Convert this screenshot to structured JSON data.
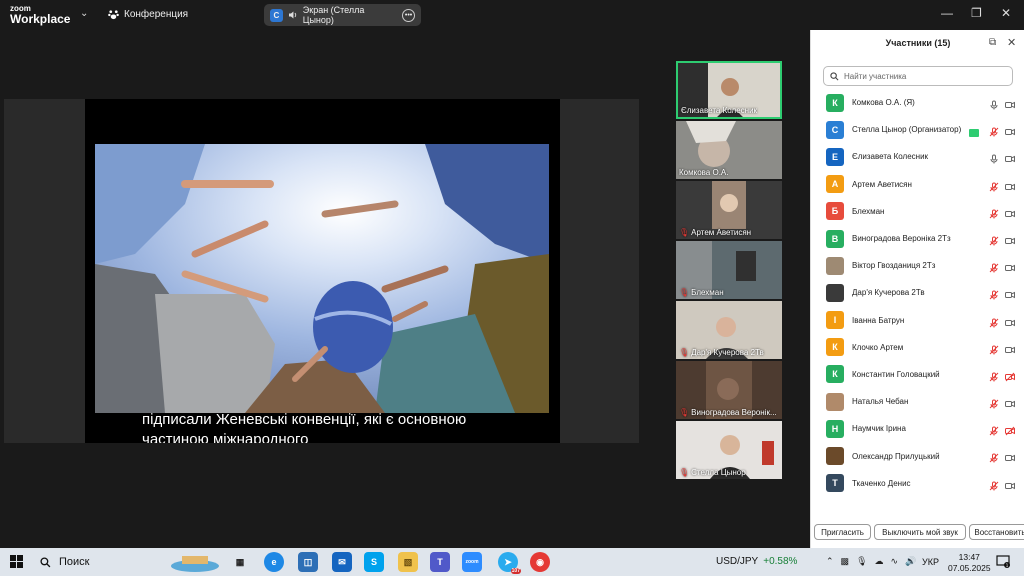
{
  "app": {
    "logo_line1": "zoom",
    "logo_line2": "Workplace",
    "meeting_label": "Конференция",
    "screen_label": "Экран (Стелла Цынор)",
    "screen_badge": "C"
  },
  "shared_screen": {
    "subtitle": "підписали Женевські конвенції, які є основною частиною міжнародного"
  },
  "thumbnails": [
    {
      "name": "Єлизавета Колесник",
      "muted": false,
      "active": true
    },
    {
      "name": "Комкова О.А.",
      "muted": false,
      "active": false
    },
    {
      "name": "Артем Аветисян",
      "muted": true,
      "active": false
    },
    {
      "name": "Блехман",
      "muted": true,
      "active": false
    },
    {
      "name": "Дар'я Кучерова 2Тв",
      "muted": true,
      "active": false
    },
    {
      "name": "Виноградова Веронік...",
      "muted": true,
      "active": false
    },
    {
      "name": "Стелла Цынор",
      "muted": true,
      "active": false
    }
  ],
  "participants_panel": {
    "title": "Участники (15)",
    "search_placeholder": "Найти участника",
    "participants": [
      {
        "name": "Комкова О.А. (Я)",
        "initial": "К",
        "color": "#27ae60",
        "mic": "on",
        "video": "on"
      },
      {
        "name": "Стелла Цынор (Организатор)",
        "initial": "С",
        "color": "#2a7fd4",
        "mic": "off",
        "video": "on",
        "sharing": true
      },
      {
        "name": "Єлизавета Колесник",
        "initial": "Е",
        "color": "#1565c0",
        "mic": "on",
        "video": "on"
      },
      {
        "name": "Артем Аветисян",
        "initial": "А",
        "color": "#f39c12",
        "mic": "off",
        "video": "on"
      },
      {
        "name": "Блехман",
        "initial": "Б",
        "color": "#e74c3c",
        "mic": "off",
        "video": "on"
      },
      {
        "name": "Виноградова Вероніка 2Тз",
        "initial": "В",
        "color": "#27ae60",
        "mic": "off",
        "video": "on"
      },
      {
        "name": "Віктор Гвозданиця 2Тз",
        "initial": "",
        "color": "#9e8a73",
        "mic": "off",
        "video": "on"
      },
      {
        "name": "Дар'я Кучерова 2Тв",
        "initial": "",
        "color": "#3a3a3a",
        "mic": "off",
        "video": "on"
      },
      {
        "name": "Іванна Батрун",
        "initial": "І",
        "color": "#f39c12",
        "mic": "off",
        "video": "on"
      },
      {
        "name": "Клочко Артем",
        "initial": "К",
        "color": "#f39c12",
        "mic": "off",
        "video": "on"
      },
      {
        "name": "Константин Головацкий",
        "initial": "К",
        "color": "#27ae60",
        "mic": "off",
        "video": "off"
      },
      {
        "name": "Наталья Чебан",
        "initial": "",
        "color": "#b08a6a",
        "mic": "off",
        "video": "on"
      },
      {
        "name": "Наумчик Ірина",
        "initial": "Н",
        "color": "#27ae60",
        "mic": "off",
        "video": "off"
      },
      {
        "name": "Олександр Прилуцький",
        "initial": "",
        "color": "#6b4a2a",
        "mic": "off",
        "video": "on"
      },
      {
        "name": "Ткаченко Денис",
        "initial": "Т",
        "color": "#34495e",
        "mic": "off",
        "video": "on"
      }
    ],
    "buttons": {
      "invite": "Пригласить",
      "mute_me": "Выключить мой звук",
      "restore": "Восстановить"
    }
  },
  "taskbar": {
    "search_label": "Поиск",
    "currency_pair": "USD/JPY",
    "currency_change": "+0.58%",
    "language": "УКР",
    "time": "13:47",
    "date": "07.05.2025",
    "telegram_badge": "107",
    "notification_count": "1"
  }
}
